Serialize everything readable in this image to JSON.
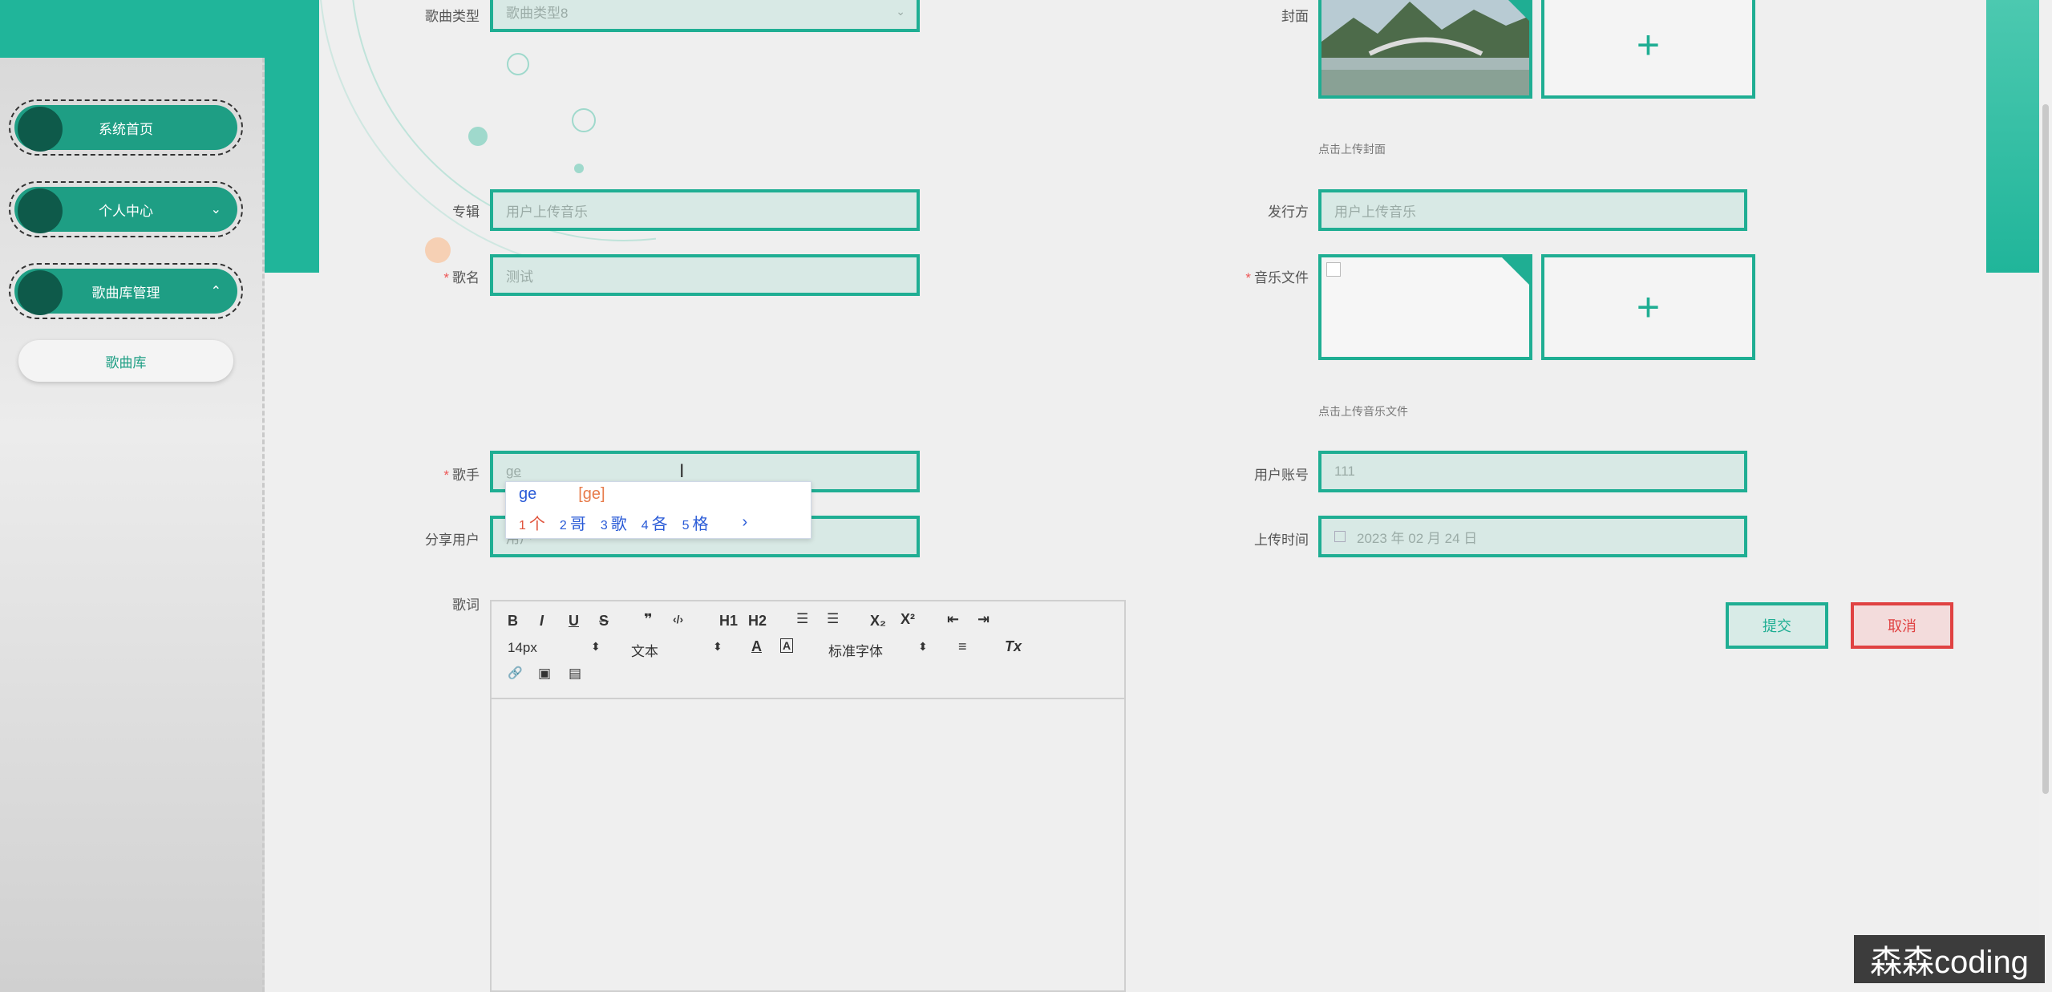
{
  "sidebar": {
    "items": [
      {
        "label": "系统首页",
        "arrow": ""
      },
      {
        "label": "个人中心",
        "arrow": "⌄"
      },
      {
        "label": "歌曲库管理",
        "arrow": "⌃"
      }
    ],
    "sub_items": [
      {
        "label": "歌曲库"
      }
    ]
  },
  "form": {
    "song_type": {
      "label": "歌曲类型",
      "value": "歌曲类型8"
    },
    "cover": {
      "label": "封面",
      "hint": "点击上传封面"
    },
    "album": {
      "label": "专辑",
      "value": "用户上传音乐"
    },
    "publisher": {
      "label": "发行方",
      "value": "用户上传音乐"
    },
    "song_name": {
      "label": "歌名",
      "value": "测试",
      "required": "*"
    },
    "music_file": {
      "label": "音乐文件",
      "hint": "点击上传音乐文件",
      "required": "*"
    },
    "singer": {
      "label": "歌手",
      "value": "ge",
      "required": "*"
    },
    "user_account": {
      "label": "用户账号",
      "value": "111"
    },
    "share_user": {
      "label": "分享用户",
      "value": "用户"
    },
    "upload_time": {
      "label": "上传时间",
      "value": "2023 年 02 月 24 日"
    },
    "lyrics": {
      "label": "歌词"
    }
  },
  "ime": {
    "input": "ge",
    "pinyin": "[ge]",
    "candidates": [
      {
        "n": "1",
        "text": "个"
      },
      {
        "n": "2",
        "text": "哥"
      },
      {
        "n": "3",
        "text": "歌"
      },
      {
        "n": "4",
        "text": "各"
      },
      {
        "n": "5",
        "text": "格"
      }
    ],
    "next": "›"
  },
  "editor": {
    "toolbar": {
      "bold": "B",
      "italic": "I",
      "underline": "U",
      "strike": "S",
      "quote": "❞",
      "code": "‹/›",
      "h1": "H1",
      "h2": "H2",
      "ol": "☰",
      "ul": "☰",
      "sub": "X₂",
      "sup": "X²",
      "outdent": "⇤",
      "indent": "⇥",
      "size": "14px",
      "size_caret": "⬍",
      "header": "文本",
      "header_caret": "⬍",
      "font_color": "A",
      "bg_color": "A",
      "font": "标准字体",
      "font_caret": "⬍",
      "align": "≡",
      "clean": "Tx",
      "link": "🔗",
      "image": "▣",
      "video": "▤"
    }
  },
  "buttons": {
    "submit": "提交",
    "cancel": "取消"
  },
  "watermark": "森森coding",
  "colors": {
    "accent": "#1fae93",
    "danger": "#e04242",
    "sidebar_dark": "#0e5a4a"
  }
}
